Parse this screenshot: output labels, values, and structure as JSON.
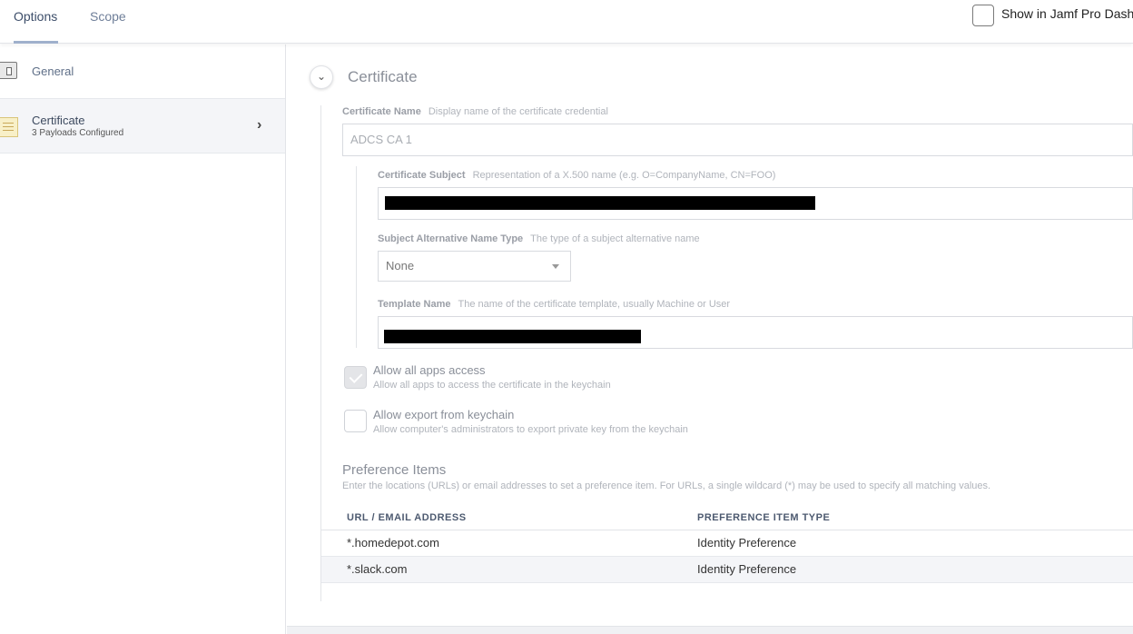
{
  "tabs": {
    "options": "Options",
    "scope": "Scope"
  },
  "dashboard": {
    "label": "Show in Jamf Pro Dash",
    "checked": false
  },
  "sidebar": {
    "items": [
      {
        "title": "General",
        "subtitle": ""
      },
      {
        "title": "Certificate",
        "subtitle": "3 Payloads Configured"
      }
    ]
  },
  "section": {
    "title": "Certificate"
  },
  "fields": {
    "cert_name": {
      "label": "Certificate Name",
      "hint": "Display name of the certificate credential",
      "value": "ADCS CA 1"
    },
    "cert_subject": {
      "label": "Certificate Subject",
      "hint": "Representation of a X.500 name (e.g. O=CompanyName, CN=FOO)"
    },
    "san_type": {
      "label": "Subject Alternative Name Type",
      "hint": "The type of a subject alternative name",
      "value": "None"
    },
    "template_name": {
      "label": "Template Name",
      "hint": "The name of the certificate template, usually Machine or User"
    }
  },
  "checkboxes": {
    "allow_apps": {
      "label": "Allow all apps access",
      "hint": "Allow all apps to access the certificate in the keychain",
      "checked": true
    },
    "allow_export": {
      "label": "Allow export from keychain",
      "hint": "Allow computer's administrators to export private key from the keychain",
      "checked": false
    }
  },
  "preferences": {
    "title": "Preference Items",
    "hint": "Enter the locations (URLs) or email addresses to set a preference item. For URLs, a single wildcard (*) may be used to specify all matching values.",
    "columns": [
      "URL / EMAIL ADDRESS",
      "PREFERENCE ITEM TYPE"
    ],
    "rows": [
      [
        "*.homedepot.com",
        "Identity Preference"
      ],
      [
        "*.slack.com",
        "Identity Preference"
      ]
    ]
  }
}
